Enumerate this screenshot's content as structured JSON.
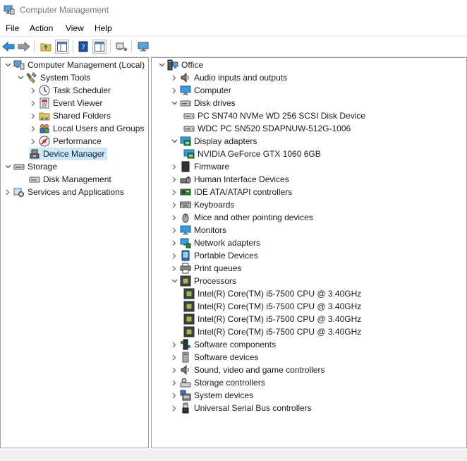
{
  "window": {
    "title": "Computer Management"
  },
  "menu": [
    "File",
    "Action",
    "View",
    "Help"
  ],
  "left_tree": [
    {
      "label": "Computer Management (Local)",
      "level": 0,
      "chevron": "down",
      "icon": "computer-management-icon"
    },
    {
      "label": "System Tools",
      "level": 1,
      "chevron": "down",
      "icon": "system-tools-icon"
    },
    {
      "label": "Task Scheduler",
      "level": 2,
      "chevron": "right",
      "icon": "clock-icon"
    },
    {
      "label": "Event Viewer",
      "level": 2,
      "chevron": "right",
      "icon": "event-viewer-icon"
    },
    {
      "label": "Shared Folders",
      "level": 2,
      "chevron": "right",
      "icon": "shared-folder-icon"
    },
    {
      "label": "Local Users and Groups",
      "level": 2,
      "chevron": "right",
      "icon": "users-icon"
    },
    {
      "label": "Performance",
      "level": 2,
      "chevron": "right",
      "icon": "performance-icon"
    },
    {
      "label": "Device Manager",
      "level": 2,
      "chevron": "",
      "icon": "device-manager-icon",
      "selected": true
    },
    {
      "label": "Storage",
      "level": 0,
      "chevron": "down",
      "icon": "storage-icon",
      "indent": 1
    },
    {
      "label": "Disk Management",
      "level": 2,
      "chevron": "",
      "icon": "disk-management-icon"
    },
    {
      "label": "Services and Applications",
      "level": 0,
      "chevron": "right",
      "icon": "services-icon",
      "indent": 1
    }
  ],
  "right_tree": [
    {
      "label": "Office",
      "level": 0,
      "chevron": "down",
      "icon": "office-computer-icon"
    },
    {
      "label": "Audio inputs and outputs",
      "level": 1,
      "chevron": "right",
      "icon": "speaker-icon"
    },
    {
      "label": "Computer",
      "level": 1,
      "chevron": "right",
      "icon": "monitor-icon"
    },
    {
      "label": "Disk drives",
      "level": 1,
      "chevron": "down",
      "icon": "disk-drive-icon"
    },
    {
      "label": "PC SN740  NVMe WD 256 SCSI Disk Device",
      "level": 2,
      "chevron": "",
      "icon": "disk-drive-icon"
    },
    {
      "label": "WDC PC SN520 SDAPNUW-512G-1006",
      "level": 2,
      "chevron": "",
      "icon": "disk-drive-icon"
    },
    {
      "label": "Display adapters",
      "level": 1,
      "chevron": "down",
      "icon": "display-adapter-icon"
    },
    {
      "label": "NVIDIA GeForce GTX 1060 6GB",
      "level": 2,
      "chevron": "",
      "icon": "display-adapter-icon"
    },
    {
      "label": "Firmware",
      "level": 1,
      "chevron": "right",
      "icon": "firmware-icon"
    },
    {
      "label": "Human Interface Devices",
      "level": 1,
      "chevron": "right",
      "icon": "hid-icon"
    },
    {
      "label": "IDE ATA/ATAPI controllers",
      "level": 1,
      "chevron": "right",
      "icon": "ide-controller-icon"
    },
    {
      "label": "Keyboards",
      "level": 1,
      "chevron": "right",
      "icon": "keyboard-icon"
    },
    {
      "label": "Mice and other pointing devices",
      "level": 1,
      "chevron": "right",
      "icon": "mouse-icon"
    },
    {
      "label": "Monitors",
      "level": 1,
      "chevron": "right",
      "icon": "monitor-icon"
    },
    {
      "label": "Network adapters",
      "level": 1,
      "chevron": "right",
      "icon": "network-adapter-icon"
    },
    {
      "label": "Portable Devices",
      "level": 1,
      "chevron": "right",
      "icon": "portable-device-icon"
    },
    {
      "label": "Print queues",
      "level": 1,
      "chevron": "right",
      "icon": "printer-icon"
    },
    {
      "label": "Processors",
      "level": 1,
      "chevron": "down",
      "icon": "processor-icon"
    },
    {
      "label": "Intel(R) Core(TM) i5-7500 CPU @ 3.40GHz",
      "level": 2,
      "chevron": "",
      "icon": "processor-icon"
    },
    {
      "label": "Intel(R) Core(TM) i5-7500 CPU @ 3.40GHz",
      "level": 2,
      "chevron": "",
      "icon": "processor-icon"
    },
    {
      "label": "Intel(R) Core(TM) i5-7500 CPU @ 3.40GHz",
      "level": 2,
      "chevron": "",
      "icon": "processor-icon"
    },
    {
      "label": "Intel(R) Core(TM) i5-7500 CPU @ 3.40GHz",
      "level": 2,
      "chevron": "",
      "icon": "processor-icon"
    },
    {
      "label": "Software components",
      "level": 1,
      "chevron": "right",
      "icon": "software-component-icon"
    },
    {
      "label": "Software devices",
      "level": 1,
      "chevron": "right",
      "icon": "software-device-icon"
    },
    {
      "label": "Sound, video and game controllers",
      "level": 1,
      "chevron": "right",
      "icon": "speaker-icon"
    },
    {
      "label": "Storage controllers",
      "level": 1,
      "chevron": "right",
      "icon": "storage-controller-icon"
    },
    {
      "label": "System devices",
      "level": 1,
      "chevron": "right",
      "icon": "system-device-icon"
    },
    {
      "label": "Universal Serial Bus controllers",
      "level": 1,
      "chevron": "right",
      "icon": "usb-icon"
    }
  ],
  "colors": {
    "selection": "#cce8ff",
    "accent_blue": "#2f8fd8",
    "pane_border": "#a0a0a0"
  }
}
